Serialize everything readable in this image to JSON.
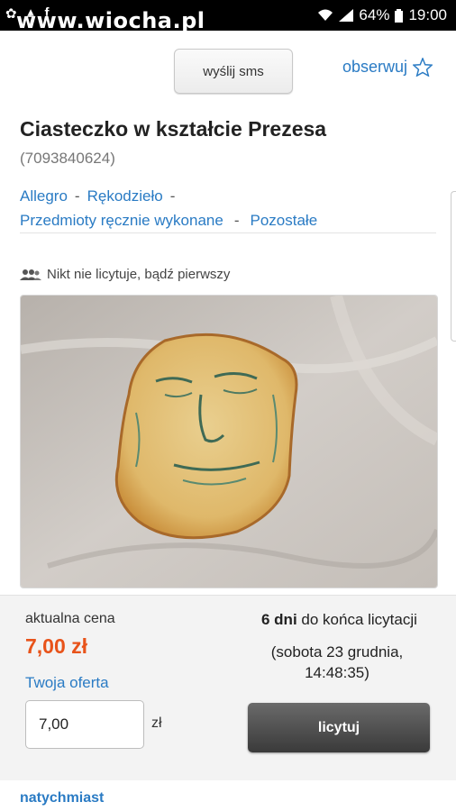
{
  "status_bar": {
    "watermark": "www.wiocha.pl",
    "battery": "64%",
    "time": "19:00",
    "left_icons": [
      "app-icon",
      "notification-icon",
      "facebook-icon"
    ]
  },
  "topbar": {
    "sms_label": "wyślij sms",
    "observe_label": "obserwuj"
  },
  "item": {
    "title": "Ciasteczko w kształcie Prezesa",
    "id": "(7093840624)"
  },
  "breadcrumbs": [
    {
      "label": "Allegro"
    },
    {
      "label": "Rękodzieło"
    },
    {
      "label": "Przedmioty ręcznie wykonane"
    },
    {
      "label": "Pozostałe"
    }
  ],
  "breadcrumb_separator": "-",
  "bidders_text": "Nikt nie licytuje, bądź pierwszy",
  "bid_panel": {
    "current_price_label": "aktualna cena",
    "current_price": "7,00 zł",
    "your_offer_label": "Twoja oferta",
    "offer_value": "7,00",
    "currency": "zł",
    "days_count": "6 dni",
    "days_suffix": "do końca licytacji",
    "end_date_line1": "(sobota 23 grudnia,",
    "end_date_line2": "14:48:35)",
    "bid_button": "licytuj"
  },
  "footer_link": "natychmiast",
  "colors": {
    "link": "#2a7bc4",
    "price": "#e8531a",
    "button_dark": "#4a4a4a",
    "panel_bg": "#f3f3f3"
  }
}
